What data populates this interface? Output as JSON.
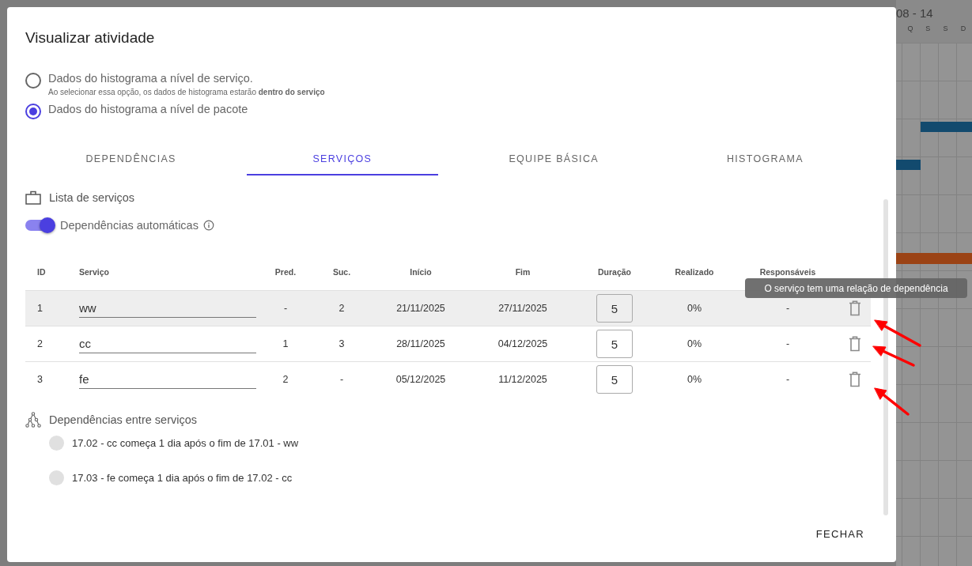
{
  "background": {
    "week_label": "08 - 14",
    "day_labels": [
      "Q",
      "S",
      "S",
      "D"
    ]
  },
  "dialog": {
    "title": "Visualizar atividade",
    "options": [
      {
        "label": "Dados do histograma a nível de serviço.",
        "note": "Ao selecionar essa opção, os dados de histograma estarão **dentro do serviço**",
        "selected": false
      },
      {
        "label": "Dados do histograma a nível de pacote",
        "selected": true
      }
    ],
    "tabs": [
      {
        "label": "DEPENDÊNCIAS",
        "selected": false
      },
      {
        "label": "SERVIÇOS",
        "selected": true
      },
      {
        "label": "EQUIPE BÁSICA",
        "selected": false
      },
      {
        "label": "HISTOGRAMA",
        "selected": false
      }
    ],
    "section_title": "Lista de serviços",
    "toggle": {
      "label": "Dependências automáticas",
      "on": true
    },
    "table": {
      "columns": [
        "ID",
        "Serviço",
        "Pred.",
        "Suc.",
        "Início",
        "Fim",
        "Duração",
        "Realizado",
        "Responsáveis"
      ],
      "rows": [
        {
          "id": "1",
          "service": "ww",
          "pred": "-",
          "suc": "2",
          "start": "21/11/2025",
          "end": "27/11/2025",
          "duration": "5",
          "done": "0%",
          "responsible": "-",
          "highlighted": true
        },
        {
          "id": "2",
          "service": "cc",
          "pred": "1",
          "suc": "3",
          "start": "28/11/2025",
          "end": "04/12/2025",
          "duration": "5",
          "done": "0%",
          "responsible": "-",
          "highlighted": false
        },
        {
          "id": "3",
          "service": "fe",
          "pred": "2",
          "suc": "-",
          "start": "05/12/2025",
          "end": "11/12/2025",
          "duration": "5",
          "done": "0%",
          "responsible": "-",
          "highlighted": false
        }
      ]
    },
    "dependencies": {
      "title": "Dependências entre serviços",
      "items": [
        "17.02 - cc começa 1 dia após o fim de 17.01 - ww",
        "17.03 - fe começa 1 dia após o fim de 17.02 - cc"
      ]
    },
    "close_button": "FECHAR"
  },
  "tooltip": "O serviço tem uma relação de dependência"
}
